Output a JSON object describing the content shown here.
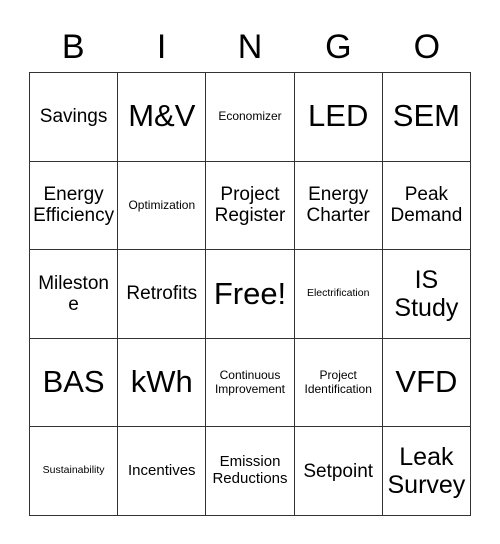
{
  "card": {
    "title": "BINGO",
    "header_letters": [
      "B",
      "I",
      "N",
      "G",
      "O"
    ],
    "free_space_label": "Free!",
    "colors": {
      "background": "#ffffff",
      "border": "#333333",
      "text": "#000000"
    },
    "rows": [
      [
        {
          "label": "Savings",
          "size": "md"
        },
        {
          "label": "M&V",
          "size": "xxl"
        },
        {
          "label": "Economizer",
          "size": "xs"
        },
        {
          "label": "LED",
          "size": "xxl"
        },
        {
          "label": "SEM",
          "size": "xxl"
        }
      ],
      [
        {
          "label": "Energy Efficiency",
          "size": "md"
        },
        {
          "label": "Optimization",
          "size": "xs"
        },
        {
          "label": "Project Register",
          "size": "md"
        },
        {
          "label": "Energy Charter",
          "size": "md"
        },
        {
          "label": "Peak Demand",
          "size": "md"
        }
      ],
      [
        {
          "label": "Milestone",
          "size": "md"
        },
        {
          "label": "Retrofits",
          "size": "md"
        },
        {
          "label": "Free!",
          "size": "xxl"
        },
        {
          "label": "Electrification",
          "size": "xxs"
        },
        {
          "label": "IS Study",
          "size": "lg"
        }
      ],
      [
        {
          "label": "BAS",
          "size": "xxl"
        },
        {
          "label": "kWh",
          "size": "xxl"
        },
        {
          "label": "Continuous Improvement",
          "size": "xs"
        },
        {
          "label": "Project Identification",
          "size": "xs"
        },
        {
          "label": "VFD",
          "size": "xxl"
        }
      ],
      [
        {
          "label": "Sustainability",
          "size": "xxs"
        },
        {
          "label": "Incentives",
          "size": "sm"
        },
        {
          "label": "Emission Reductions",
          "size": "sm"
        },
        {
          "label": "Setpoint",
          "size": "md"
        },
        {
          "label": "Leak Survey",
          "size": "lg"
        }
      ]
    ]
  }
}
